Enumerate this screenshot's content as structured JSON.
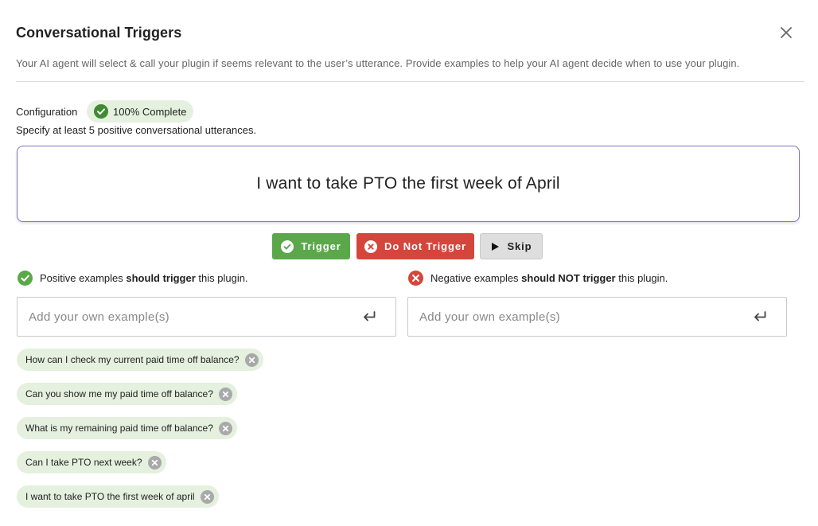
{
  "dialog": {
    "title": "Conversational Triggers",
    "subtitle": "Your AI agent will select & call your plugin if seems relevant to the user’s utterance. Provide examples to help your AI agent decide when to use your plugin."
  },
  "configuration": {
    "label": "Configuration",
    "status_badge": "100% Complete",
    "instruction": "Specify at least 5 positive conversational utterances."
  },
  "current_utterance": "I want to take PTO the first week of April",
  "actions": {
    "trigger_label": "Trigger",
    "do_not_trigger_label": "Do Not Trigger",
    "skip_label": "Skip"
  },
  "positive": {
    "text_before": "Positive examples ",
    "text_bold": "should trigger",
    "text_after": " this plugin.",
    "placeholder": "Add your own example(s)",
    "examples": [
      "How can I check my current paid time off balance?",
      "Can you show me my paid time off balance?",
      "What is my remaining paid time off balance?",
      "Can I take PTO next week?",
      "I want to take PTO the first week of april"
    ]
  },
  "negative": {
    "text_before": "Negative examples ",
    "text_bold": "should NOT trigger",
    "text_after": " this plugin.",
    "placeholder": "Add your own example(s)",
    "examples": []
  },
  "icons": {
    "close": "close-icon",
    "complete": "check-circle-icon",
    "trigger": "check-circle-icon",
    "do_not_trigger": "x-circle-icon",
    "skip": "play-icon",
    "submit": "enter-return-icon",
    "remove": "x-circle-icon"
  },
  "colors": {
    "success": "#5aa84a",
    "success_dark": "#3f8a33",
    "danger": "#d4463b",
    "chip_bg": "#e5f0df",
    "focus_border": "#7b72c4"
  }
}
